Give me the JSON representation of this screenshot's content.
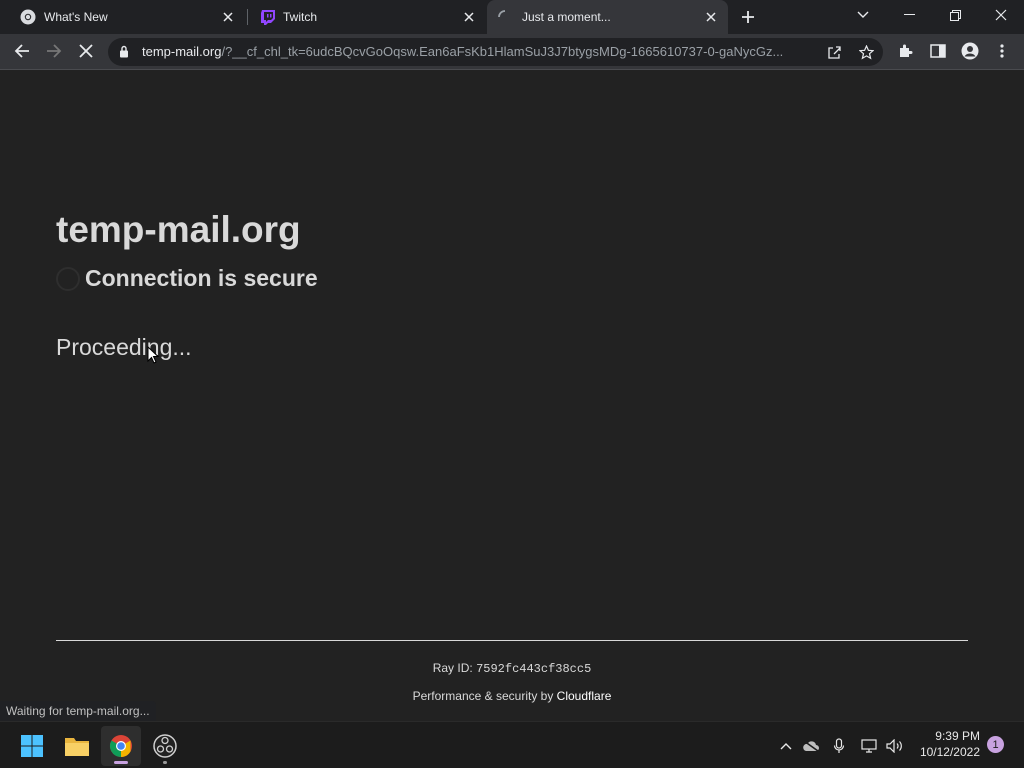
{
  "browser": {
    "tabs": [
      {
        "title": "What's New",
        "favicon": "chrome-icon"
      },
      {
        "title": "Twitch",
        "favicon": "twitch-icon"
      },
      {
        "title": "Just a moment...",
        "favicon": "loading-spinner-icon"
      }
    ],
    "url_host": "temp-mail.org",
    "url_rest": "/?__cf_chl_tk=6udcBQcvGoOqsw.Ean6aFsKb1HlamSuJ3J7btygsMDg-1665610737-0-gaNycGz...",
    "status_text": "Waiting for temp-mail.org..."
  },
  "page": {
    "site_title": "temp-mail.org",
    "secure_text": "Connection is secure",
    "proceeding_text": "Proceeding...",
    "ray_label": "Ray ID: ",
    "ray_id": "7592fc443cf38cc5",
    "perf_prefix": "Performance & security by ",
    "perf_brand": "Cloudflare"
  },
  "taskbar": {
    "apps": [
      "windows-start-icon",
      "file-explorer-icon",
      "chrome-icon",
      "obs-icon"
    ],
    "time": "9:39 PM",
    "date": "10/12/2022",
    "notification_count": "1"
  },
  "colors": {
    "page_bg": "#222222",
    "accent": "#c8a2e0"
  }
}
